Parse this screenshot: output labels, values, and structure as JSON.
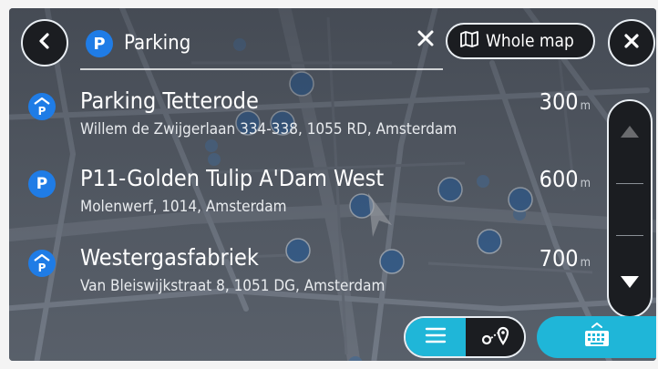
{
  "search": {
    "query": "Parking",
    "category_badge": "P",
    "whole_map_label": "Whole map"
  },
  "results": [
    {
      "name": "Parking Tetterode",
      "address": "Willem de Zwijgerlaan 334-338, 1055 RD, Amsterdam",
      "distance": "300",
      "unit": "m",
      "icon": "parking-garage-icon"
    },
    {
      "name": "P11-Golden Tulip A'Dam West",
      "address": "Molenwerf, 1014, Amsterdam",
      "distance": "600",
      "unit": "m",
      "icon": "parking-icon"
    },
    {
      "name": "Westergasfabriek",
      "address": "Van Bleiswijkstraat 8, 1051 DG, Amsterdam",
      "distance": "700",
      "unit": "m",
      "icon": "parking-garage-icon"
    }
  ],
  "colors": {
    "accent": "#1fb6d8",
    "pin_blue": "#1f7ce6",
    "button_bg": "#1b1d21"
  },
  "icons": {
    "back": "chevron-left-icon",
    "close": "close-icon",
    "clear": "clear-x-icon",
    "whole_map": "map-icon",
    "scroll_up": "chevron-up-icon",
    "scroll_down": "chevron-down-icon",
    "list": "list-icon",
    "route": "route-icon",
    "keyboard": "keyboard-icon"
  }
}
